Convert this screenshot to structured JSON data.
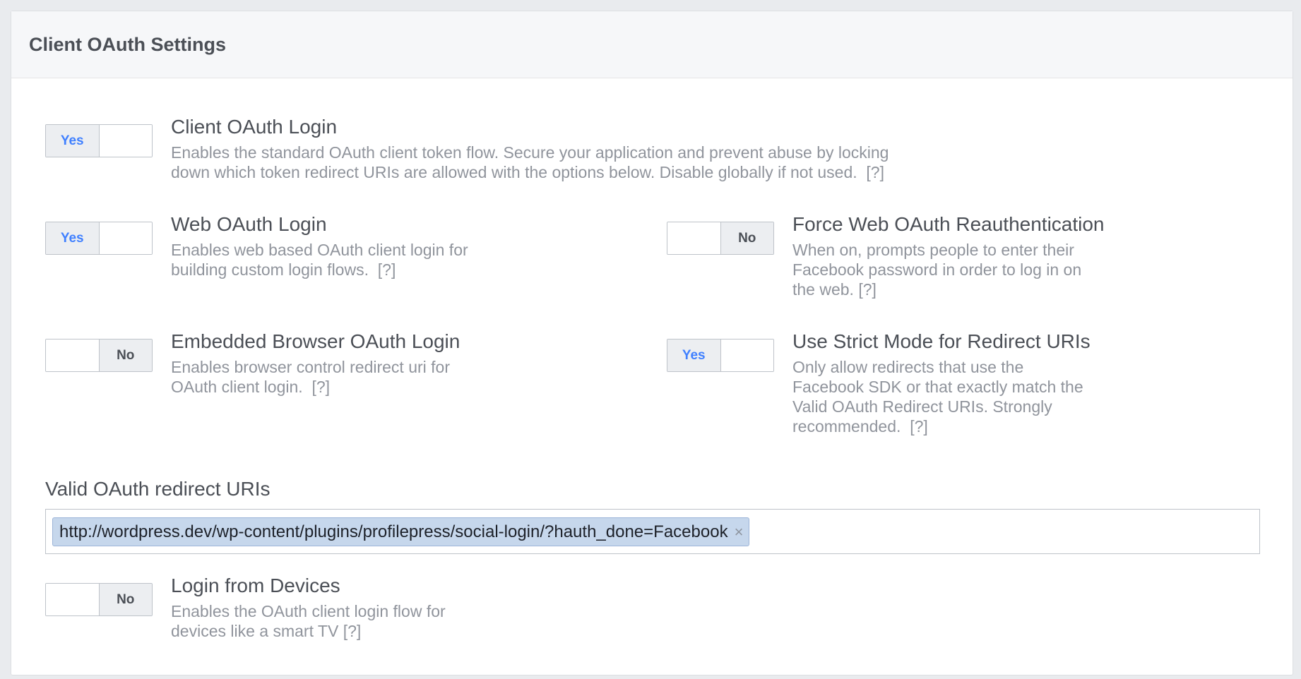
{
  "panel": {
    "title": "Client OAuth Settings"
  },
  "settings": {
    "client_oauth_login": {
      "toggle": {
        "state": "Yes"
      },
      "title": "Client OAuth Login",
      "desc_line1": "Enables the standard OAuth client token flow. Secure your application and prevent abuse by locking",
      "desc_line2": "down which token redirect URIs are allowed with the options below. Disable globally if not used.",
      "help": "[?]"
    },
    "web_oauth_login": {
      "toggle": {
        "state": "Yes"
      },
      "title": "Web OAuth Login",
      "desc_line1": "Enables web based OAuth client login for",
      "desc_line2": "building custom login flows.",
      "help": "[?]"
    },
    "force_reauth": {
      "toggle": {
        "state": "No"
      },
      "title": "Force Web OAuth Reauthentication",
      "desc_line1": "When on, prompts people to enter their",
      "desc_line2": "Facebook password in order to log in on",
      "desc_line3": "the web.",
      "help": "[?]"
    },
    "embedded_browser": {
      "toggle": {
        "state": "No"
      },
      "title": "Embedded Browser OAuth Login",
      "desc_line1": "Enables browser control redirect uri for",
      "desc_line2": "OAuth client login.",
      "help": "[?]"
    },
    "strict_mode": {
      "toggle": {
        "state": "Yes"
      },
      "title": "Use Strict Mode for Redirect URIs",
      "desc_line1": "Only allow redirects that use the",
      "desc_line2": "Facebook SDK or that exactly match the",
      "desc_line3": "Valid OAuth Redirect URIs. Strongly",
      "desc_line4": "recommended.",
      "help": "[?]"
    },
    "login_from_devices": {
      "toggle": {
        "state": "No"
      },
      "title": "Login from Devices",
      "desc_line1": "Enables the OAuth client login flow for",
      "desc_line2": "devices like a smart TV",
      "help": "[?]"
    }
  },
  "redirect_uris": {
    "label": "Valid OAuth redirect URIs",
    "values": [
      "http://wordpress.dev/wp-content/plugins/profilepress/social-login/?hauth_done=Facebook"
    ],
    "remove_glyph": "×"
  },
  "colors": {
    "yes_text": "#4080ff",
    "chip_bg": "#c6d7ec",
    "page_bg": "#e9ebee"
  }
}
